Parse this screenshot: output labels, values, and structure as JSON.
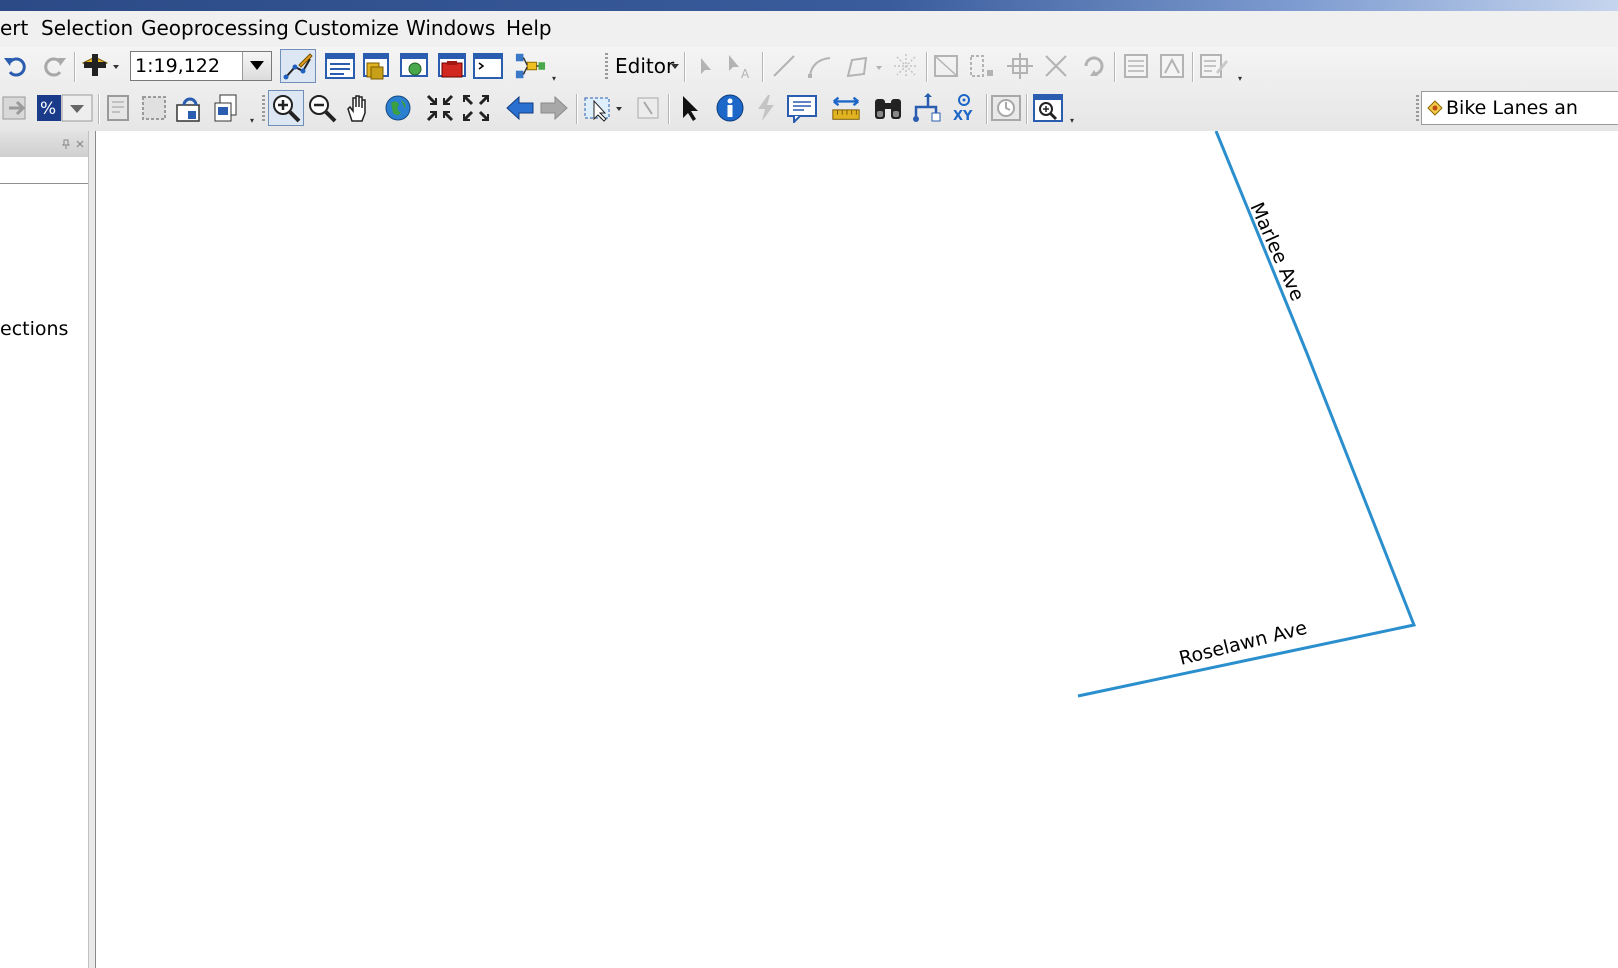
{
  "menu": {
    "items": [
      "ert",
      "Selection",
      "Geoprocessing",
      "Customize",
      "Windows",
      "Help"
    ]
  },
  "standard_toolbar": {
    "scale_value": "1:19,122"
  },
  "editor_toolbar": {
    "label": "Editor"
  },
  "layer_selector": {
    "value": "Bike Lanes an"
  },
  "toc_panel": {
    "visible_text": "ections"
  },
  "map": {
    "line_color": "#2b8fce",
    "streets": [
      {
        "label": "Marlee Ave"
      },
      {
        "label": "Roselawn Ave"
      }
    ]
  },
  "icons": [
    "undo-icon",
    "redo-icon",
    "add-data-icon",
    "editor-toolbar-icon",
    "table-of-contents-icon",
    "catalog-icon",
    "search-window-icon",
    "arctoolbox-icon",
    "python-icon",
    "modelbuilder-icon",
    "zoom-in-icon",
    "zoom-out-icon",
    "pan-icon",
    "full-extent-icon",
    "fixed-zoom-in-icon",
    "fixed-zoom-out-icon",
    "back-extent-icon",
    "forward-extent-icon",
    "select-features-icon",
    "select-elements-icon",
    "identify-icon",
    "hyperlink-icon",
    "html-popup-icon",
    "measure-icon",
    "find-icon",
    "find-route-icon",
    "go-to-xy-icon",
    "time-slider-icon",
    "magnifier-icon"
  ]
}
